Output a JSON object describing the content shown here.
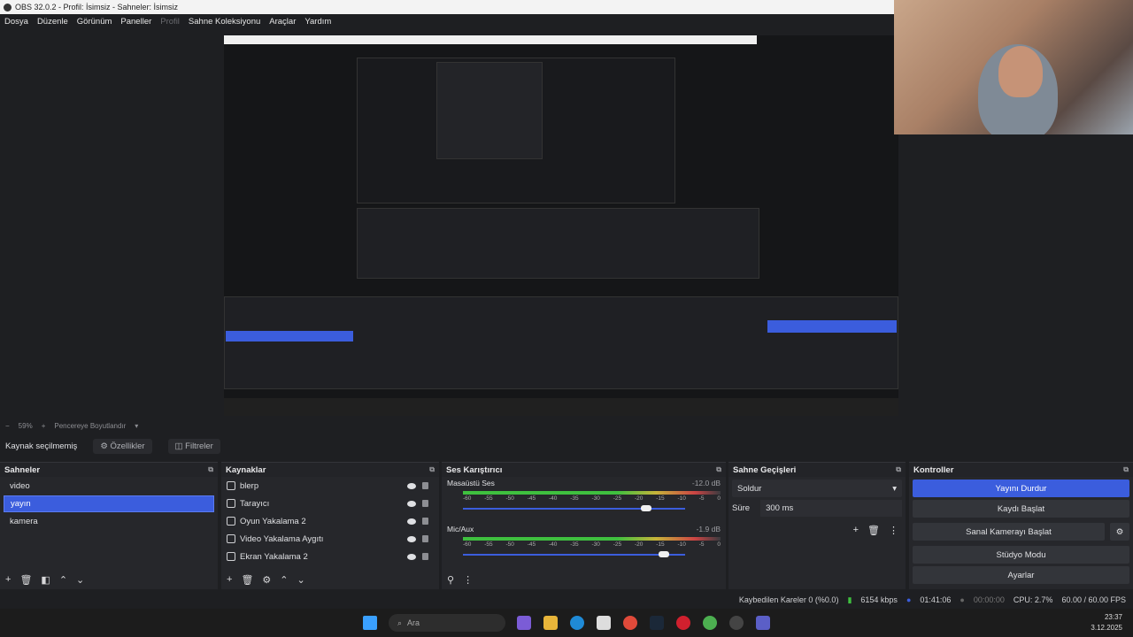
{
  "window": {
    "title": "OBS 32.0.2 - Profil: İsimsiz - Sahneler: İsimsiz"
  },
  "menu": [
    "Dosya",
    "Düzenle",
    "Görünüm",
    "Paneller",
    "Profil",
    "Sahne Koleksiyonu",
    "Araçlar",
    "Yardım"
  ],
  "zoom": {
    "value": "59%",
    "mode": "Pencereye Boyutlandır"
  },
  "source_bar": {
    "label": "Kaynak seçilmemiş",
    "properties": "Özellikler",
    "filters": "Filtreler"
  },
  "scenes": {
    "title": "Sahneler",
    "items": [
      "video",
      "yayın",
      "kamera"
    ],
    "selected": "yayın"
  },
  "sources": {
    "title": "Kaynaklar",
    "items": [
      "blerp",
      "Tarayıcı",
      "Oyun Yakalama 2",
      "Video Yakalama Aygıtı",
      "Ekran Yakalama 2"
    ]
  },
  "mixer": {
    "title": "Ses Karıştırıcı",
    "channels": [
      {
        "name": "Masaüstü Ses",
        "db": "-12.0 dB",
        "fader": 0.92
      },
      {
        "name": "Mic/Aux",
        "db": "-1.9 dB",
        "fader": 0.98
      }
    ],
    "ticks": [
      "-60",
      "-55",
      "-50",
      "-45",
      "-40",
      "-35",
      "-30",
      "-25",
      "-20",
      "-15",
      "-10",
      "-5",
      "0"
    ]
  },
  "transitions": {
    "title": "Sahne Geçişleri",
    "selected": "Soldur",
    "duration_label": "Süre",
    "duration": "300 ms"
  },
  "controls": {
    "title": "Kontroller",
    "buttons": [
      "Yayını Durdur",
      "Kaydı Başlat",
      "Sanal Kamerayı Başlat",
      "Stüdyo Modu",
      "Ayarlar"
    ]
  },
  "status": {
    "dropped": "Kaybedilen Kareler 0 (%0.0)",
    "bitrate": "6154 kbps",
    "live_time": "01:41:06",
    "rec_time": "00:00:00",
    "cpu": "CPU: 2.7%",
    "fps": "60.00 / 60.00 FPS"
  },
  "taskbar": {
    "search_placeholder": "Ara",
    "time": "23:37",
    "date": "3.12.2025"
  },
  "colors": {
    "accent": "#3b5ddd",
    "panel": "#26272b",
    "background": "#1e1f22"
  }
}
